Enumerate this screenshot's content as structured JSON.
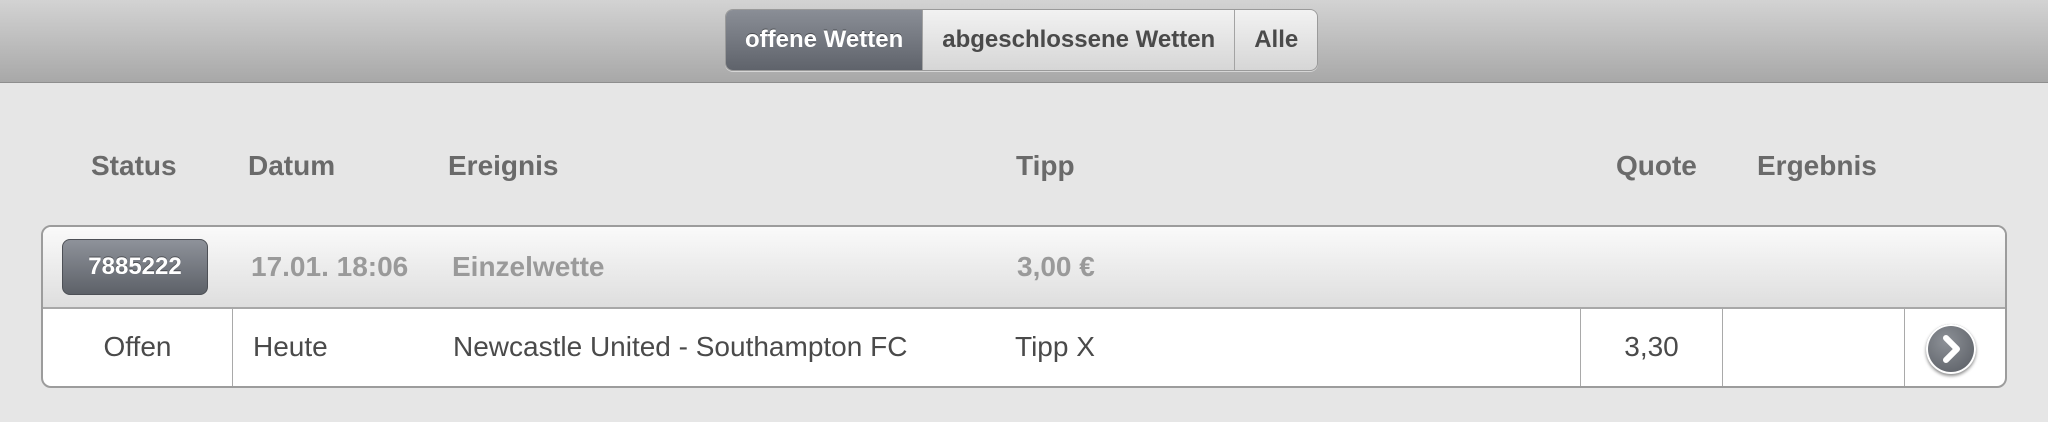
{
  "tabs": [
    {
      "label": "offene Wetten",
      "active": true
    },
    {
      "label": "abgeschlossene Wetten",
      "active": false
    },
    {
      "label": "Alle",
      "active": false
    }
  ],
  "columns": {
    "status": "Status",
    "datum": "Datum",
    "ereignis": "Ereignis",
    "tipp": "Tipp",
    "quote": "Quote",
    "ergebnis": "Ergebnis"
  },
  "bet": {
    "id": "7885222",
    "datetime": "17.01. 18:06",
    "type": "Einzelwette",
    "stake": "3,00 €",
    "rows": [
      {
        "status": "Offen",
        "datum": "Heute",
        "ereignis": "Newcastle United - Southampton FC",
        "tipp": "Tipp X",
        "quote": "3,30",
        "ergebnis": ""
      }
    ]
  },
  "icons": {
    "detail": "chevron-right-circle-icon"
  },
  "colors": {
    "active_tab": "#6f737b",
    "background": "#e6e6e6"
  }
}
